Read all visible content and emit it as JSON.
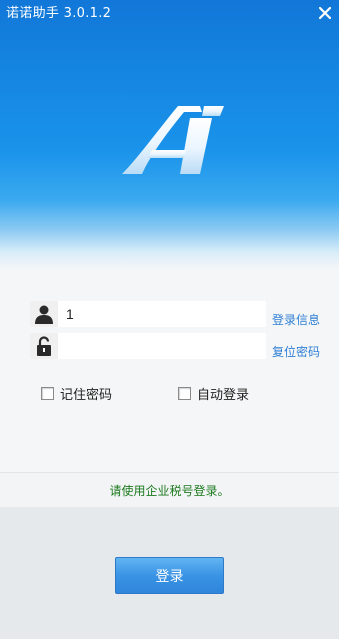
{
  "window": {
    "title": "诺诺助手 3.0.1.2",
    "colors": {
      "header_blue": "#1483e0",
      "link": "#2f7fd6",
      "notice": "#1c7a1c",
      "button": "#3a93e4"
    }
  },
  "logo": {
    "icon": "a-logo-icon"
  },
  "form": {
    "username_value": "1",
    "password_value": "",
    "login_info_link": "登录信息",
    "reset_password_link": "复位密码",
    "remember_password_label": "记住密码",
    "auto_login_label": "自动登录",
    "remember_password_checked": false,
    "auto_login_checked": false
  },
  "notice": "请使用企业税号登录。",
  "login_button": "登录"
}
